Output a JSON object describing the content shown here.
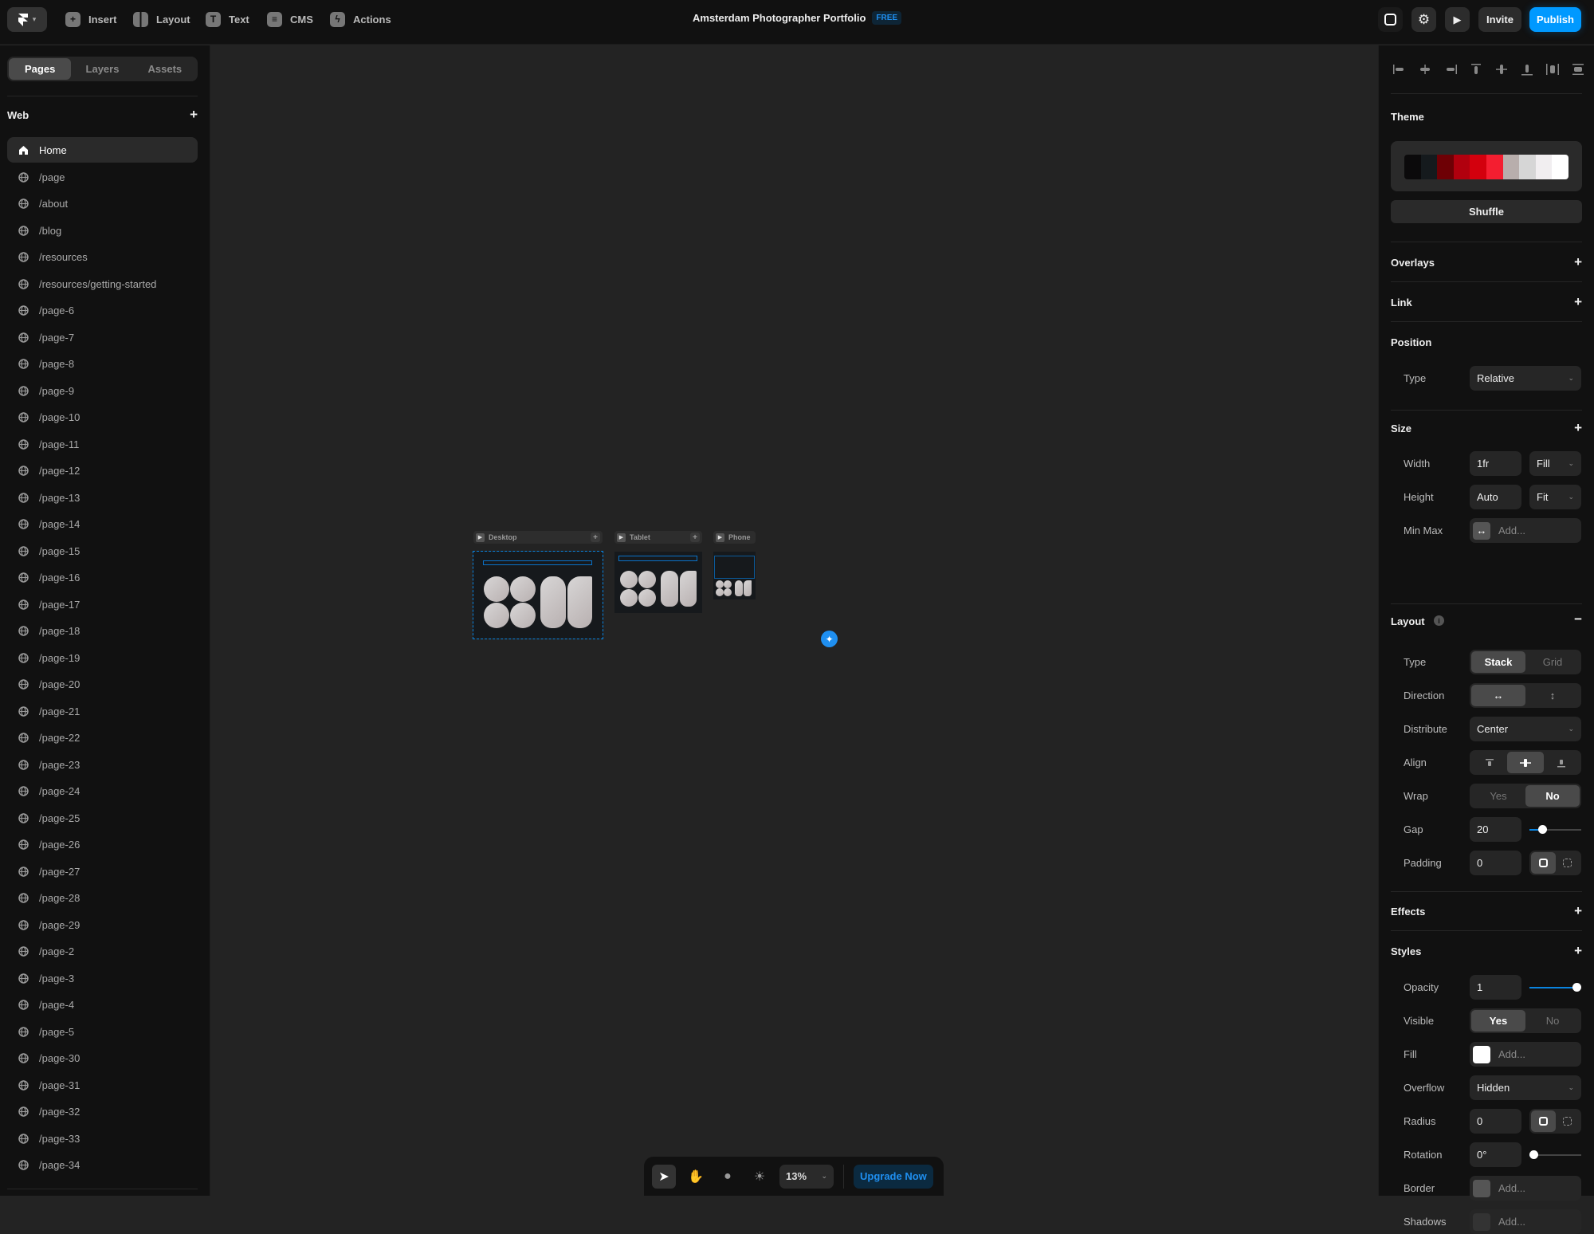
{
  "topbar": {
    "menu": [
      {
        "label": "Insert",
        "icon": "plus-square-icon"
      },
      {
        "label": "Layout",
        "icon": "layout-icon"
      },
      {
        "label": "Text",
        "icon": "text-icon"
      },
      {
        "label": "CMS",
        "icon": "database-icon"
      },
      {
        "label": "Actions",
        "icon": "lightning-icon"
      }
    ],
    "project_title": "Amsterdam Photographer Portfolio",
    "plan_badge": "FREE",
    "invite_label": "Invite",
    "publish_label": "Publish"
  },
  "left_panel": {
    "tabs": [
      {
        "label": "Pages",
        "active": true
      },
      {
        "label": "Layers",
        "active": false
      },
      {
        "label": "Assets",
        "active": false
      }
    ],
    "section_title": "Web",
    "home_label": "Home",
    "pages": [
      "/page",
      "/about",
      "/blog",
      "/resources",
      "/resources/getting-started",
      "/page-6",
      "/page-7",
      "/page-8",
      "/page-9",
      "/page-10",
      "/page-11",
      "/page-12",
      "/page-13",
      "/page-14",
      "/page-15",
      "/page-16",
      "/page-17",
      "/page-18",
      "/page-19",
      "/page-20",
      "/page-21",
      "/page-22",
      "/page-23",
      "/page-24",
      "/page-25",
      "/page-26",
      "/page-27",
      "/page-28",
      "/page-29",
      "/page-2",
      "/page-3",
      "/page-4",
      "/page-5",
      "/page-30",
      "/page-31",
      "/page-32",
      "/page-33",
      "/page-34"
    ]
  },
  "canvas": {
    "breakpoints": [
      {
        "label": "Desktop"
      },
      {
        "label": "Tablet"
      },
      {
        "label": "Phone"
      }
    ]
  },
  "bottombar": {
    "zoom": "13%",
    "upgrade_label": "Upgrade Now"
  },
  "right_panel": {
    "theme": {
      "title": "Theme",
      "colors": [
        "#0b0a0b",
        "#151a1d",
        "#6e0005",
        "#b1000e",
        "#d3000d",
        "#f41e30",
        "#b8aeac",
        "#d6d6d6",
        "#f1eef0",
        "#ffffff"
      ],
      "shuffle_label": "Shuffle"
    },
    "overlays": {
      "title": "Overlays"
    },
    "link": {
      "title": "Link"
    },
    "position": {
      "title": "Position",
      "type_label": "Type",
      "type_value": "Relative"
    },
    "size": {
      "title": "Size",
      "width_label": "Width",
      "width_value": "1fr",
      "width_mode": "Fill",
      "height_label": "Height",
      "height_value": "Auto",
      "height_mode": "Fit",
      "minmax_label": "Min Max",
      "minmax_placeholder": "Add..."
    },
    "layout": {
      "title": "Layout",
      "type_label": "Type",
      "type_options": [
        "Stack",
        "Grid"
      ],
      "type_selected": "Stack",
      "direction_label": "Direction",
      "distribute_label": "Distribute",
      "distribute_value": "Center",
      "align_label": "Align",
      "wrap_label": "Wrap",
      "wrap_options": [
        "Yes",
        "No"
      ],
      "wrap_selected": "No",
      "gap_label": "Gap",
      "gap_value": "20",
      "gap_slider_fraction": 0.2,
      "padding_label": "Padding",
      "padding_value": "0"
    },
    "effects": {
      "title": "Effects"
    },
    "styles": {
      "title": "Styles",
      "opacity_label": "Opacity",
      "opacity_value": "1",
      "opacity_slider_fraction": 1.0,
      "visible_label": "Visible",
      "visible_options": [
        "Yes",
        "No"
      ],
      "visible_selected": "Yes",
      "fill_label": "Fill",
      "fill_placeholder": "Add...",
      "fill_color": "#ffffff",
      "overflow_label": "Overflow",
      "overflow_value": "Hidden",
      "radius_label": "Radius",
      "radius_value": "0",
      "rotation_label": "Rotation",
      "rotation_value": "0°",
      "rotation_slider_fraction": 0.0,
      "border_label": "Border",
      "border_placeholder": "Add...",
      "shadows_label": "Shadows",
      "shadows_placeholder": "Add..."
    }
  }
}
